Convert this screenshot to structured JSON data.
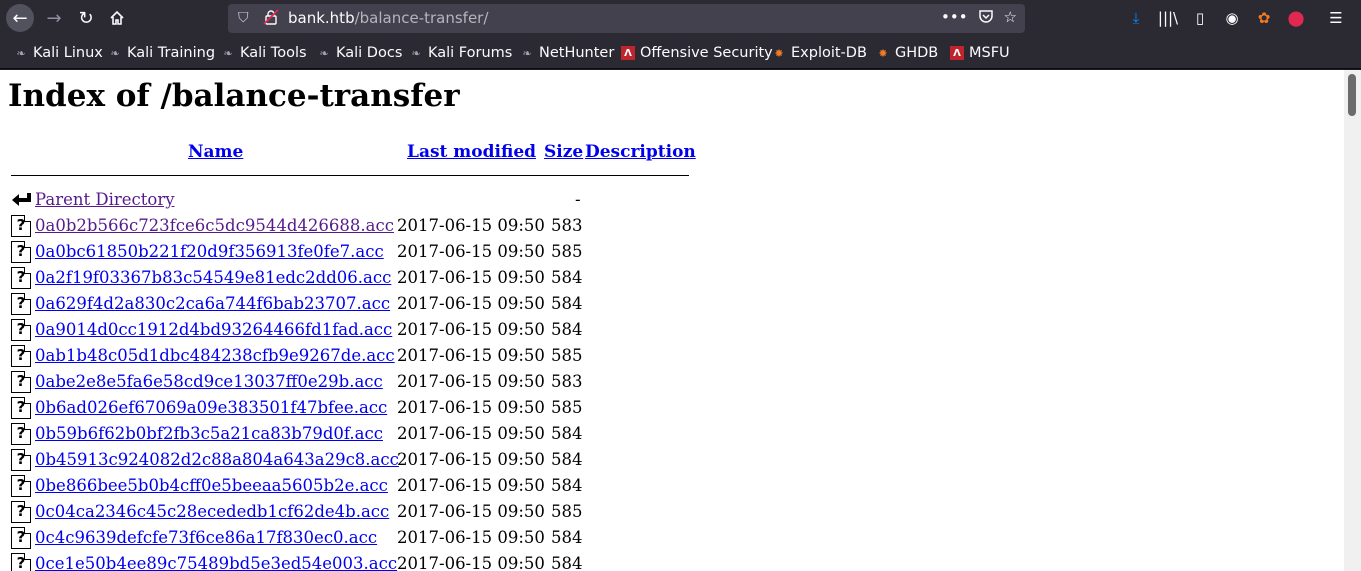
{
  "browser": {
    "url_host": "bank.htb",
    "url_path": "/balance-transfer/",
    "bookmarks": [
      "Kali Linux",
      "Kali Training",
      "Kali Tools",
      "Kali Docs",
      "Kali Forums",
      "NetHunter",
      "Offensive Security",
      "Exploit-DB",
      "GHDB",
      "MSFU"
    ]
  },
  "page": {
    "title": "Index of /balance-transfer",
    "headers": {
      "name": "Name",
      "modified": "Last modified",
      "size": "Size",
      "description": "Description"
    },
    "parent": {
      "label": "Parent Directory",
      "size": "-"
    },
    "files": [
      {
        "name": "0a0b2b566c723fce6c5dc9544d426688.acc",
        "modified": "2017-06-15 09:50",
        "size": "583",
        "visited": true
      },
      {
        "name": "0a0bc61850b221f20d9f356913fe0fe7.acc",
        "modified": "2017-06-15 09:50",
        "size": "585"
      },
      {
        "name": "0a2f19f03367b83c54549e81edc2dd06.acc",
        "modified": "2017-06-15 09:50",
        "size": "584"
      },
      {
        "name": "0a629f4d2a830c2ca6a744f6bab23707.acc",
        "modified": "2017-06-15 09:50",
        "size": "584"
      },
      {
        "name": "0a9014d0cc1912d4bd93264466fd1fad.acc",
        "modified": "2017-06-15 09:50",
        "size": "584"
      },
      {
        "name": "0ab1b48c05d1dbc484238cfb9e9267de.acc",
        "modified": "2017-06-15 09:50",
        "size": "585"
      },
      {
        "name": "0abe2e8e5fa6e58cd9ce13037ff0e29b.acc",
        "modified": "2017-06-15 09:50",
        "size": "583"
      },
      {
        "name": "0b6ad026ef67069a09e383501f47bfee.acc",
        "modified": "2017-06-15 09:50",
        "size": "585"
      },
      {
        "name": "0b59b6f62b0bf2fb3c5a21ca83b79d0f.acc",
        "modified": "2017-06-15 09:50",
        "size": "584"
      },
      {
        "name": "0b45913c924082d2c88a804a643a29c8.acc",
        "modified": "2017-06-15 09:50",
        "size": "584"
      },
      {
        "name": "0be866bee5b0b4cff0e5beeaa5605b2e.acc",
        "modified": "2017-06-15 09:50",
        "size": "584"
      },
      {
        "name": "0c04ca2346c45c28ecededb1cf62de4b.acc",
        "modified": "2017-06-15 09:50",
        "size": "585"
      },
      {
        "name": "0c4c9639defcfe73f6ce86a17f830ec0.acc",
        "modified": "2017-06-15 09:50",
        "size": "584"
      },
      {
        "name": "0ce1e50b4ee89c75489bd5e3ed54e003.acc",
        "modified": "2017-06-15 09:50",
        "size": "584"
      }
    ]
  }
}
